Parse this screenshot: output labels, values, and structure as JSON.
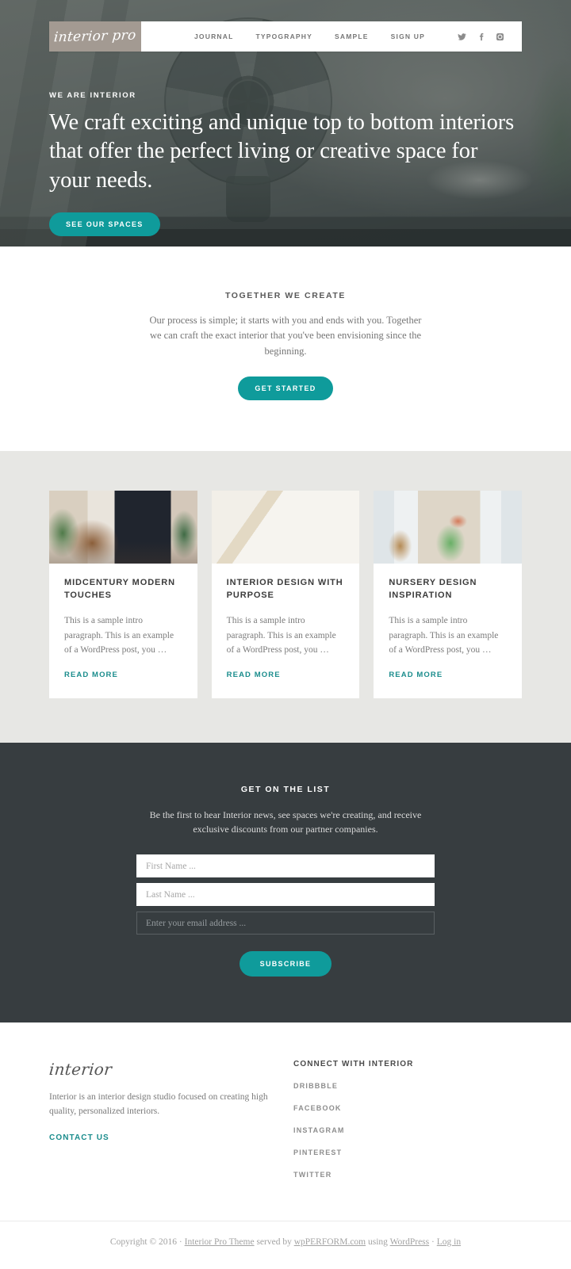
{
  "header": {
    "logo": "interior pro",
    "nav": [
      {
        "label": "JOURNAL"
      },
      {
        "label": "TYPOGRAPHY"
      },
      {
        "label": "SAMPLE"
      },
      {
        "label": "SIGN UP"
      }
    ],
    "social": [
      {
        "name": "twitter-icon"
      },
      {
        "name": "facebook-icon"
      },
      {
        "name": "instagram-icon"
      }
    ]
  },
  "hero": {
    "kicker": "WE ARE INTERIOR",
    "title": "We craft exciting and unique top to bottom interiors that offer the perfect living or creative space for your needs.",
    "cta": "SEE OUR SPACES"
  },
  "intro": {
    "title": "TOGETHER WE CREATE",
    "text": "Our process is simple; it starts with you and ends with you. Together we can craft the exact interior that you've been envisioning since the beginning.",
    "cta": "GET STARTED"
  },
  "blog": {
    "posts": [
      {
        "title": "MIDCENTURY MODERN TOUCHES",
        "excerpt": "This is a sample intro paragraph. This is an example of a WordPress post, you …",
        "more": "READ MORE"
      },
      {
        "title": "INTERIOR DESIGN WITH PURPOSE",
        "excerpt": "This is a sample intro paragraph. This is an example of a WordPress post, you …",
        "more": "READ MORE"
      },
      {
        "title": "NURSERY DESIGN INSPIRATION",
        "excerpt": "This is a sample intro paragraph. This is an example of a WordPress post, you …",
        "more": "READ MORE"
      }
    ]
  },
  "newsletter": {
    "title": "GET ON THE LIST",
    "text": "Be the first to hear Interior news, see spaces we're creating, and receive exclusive discounts from our partner companies.",
    "first_name_placeholder": "First Name ...",
    "last_name_placeholder": "Last Name ...",
    "email_placeholder": "Enter your email address ...",
    "first_name_value": "",
    "last_name_value": "",
    "email_value": "",
    "cta": "SUBSCRIBE"
  },
  "footer_widgets": {
    "logo": "interior",
    "description": "Interior is an interior design studio focused on creating high quality, personalized interiors.",
    "contact": "CONTACT US",
    "connect_heading": "CONNECT WITH INTERIOR",
    "connect_links": [
      {
        "label": "DRIBBBLE"
      },
      {
        "label": "FACEBOOK"
      },
      {
        "label": "INSTAGRAM"
      },
      {
        "label": "PINTEREST"
      },
      {
        "label": "TWITTER"
      }
    ]
  },
  "site_footer": {
    "copyright_prefix": "Copyright © 2016 · ",
    "theme_link": "Interior Pro Theme",
    "served_by": " served by ",
    "host_link": "wpPERFORM.com",
    "using": " using ",
    "wordpress_link": "WordPress",
    "separator": " · ",
    "login_link": "Log in"
  },
  "colors": {
    "accent": "#0f9b9b",
    "link": "#1a8c8c",
    "dark_section": "#373d40",
    "blog_bg": "#e7e7e4",
    "logo_bg": "#a39a92"
  }
}
